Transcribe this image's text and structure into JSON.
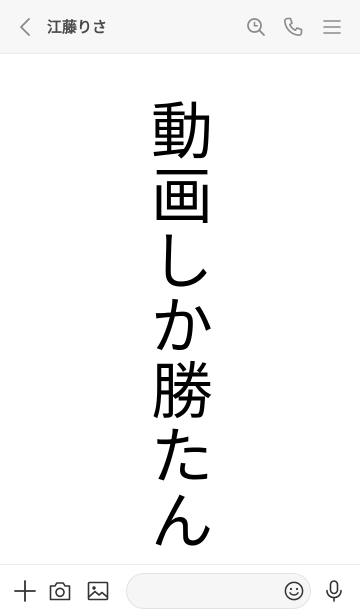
{
  "header": {
    "chat_title": "江藤りさ",
    "back_icon": "chevron-left-icon",
    "search_icon": "search-icon",
    "call_icon": "phone-icon",
    "menu_icon": "menu-icon"
  },
  "content": {
    "chars": [
      "動",
      "画",
      "し",
      "か",
      "勝",
      "た",
      "ん"
    ]
  },
  "footer": {
    "add_icon": "plus-icon",
    "camera_icon": "camera-icon",
    "image_icon": "image-icon",
    "message_placeholder": "",
    "emoji_icon": "smiley-icon",
    "mic_icon": "microphone-icon"
  },
  "colors": {
    "header_bg": "#f7f7f7",
    "icon": "#8a8a8a",
    "title": "#4a4a4a",
    "text": "#000000"
  }
}
